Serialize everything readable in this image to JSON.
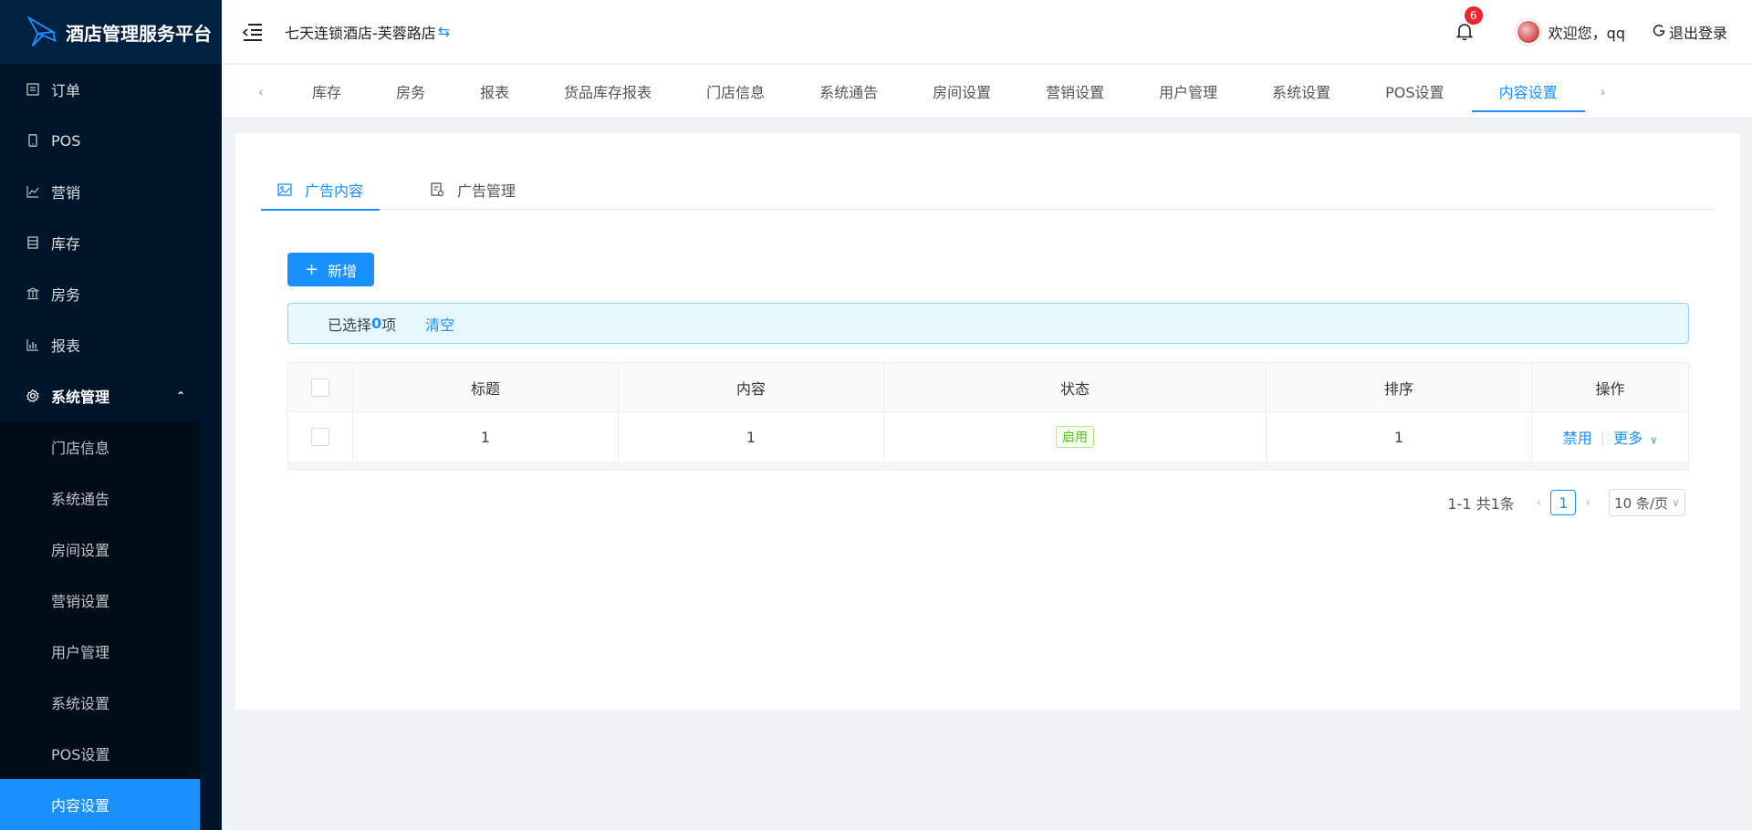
{
  "app": {
    "title": "酒店管理服务平台"
  },
  "sidebar": {
    "items": [
      {
        "label": "订单",
        "icon": "order-icon"
      },
      {
        "label": "POS",
        "icon": "mobile-icon"
      },
      {
        "label": "营销",
        "icon": "line-chart-icon"
      },
      {
        "label": "库存",
        "icon": "inventory-icon"
      },
      {
        "label": "房务",
        "icon": "bank-icon"
      },
      {
        "label": "报表",
        "icon": "bar-chart-icon"
      }
    ],
    "open_group": {
      "label": "系统管理",
      "icon": "gear-icon"
    },
    "sub_items": [
      {
        "label": "门店信息"
      },
      {
        "label": "系统通告"
      },
      {
        "label": "房间设置"
      },
      {
        "label": "营销设置"
      },
      {
        "label": "用户管理"
      },
      {
        "label": "系统设置"
      },
      {
        "label": "POS设置"
      },
      {
        "label": "内容设置",
        "active": true
      }
    ]
  },
  "header": {
    "hotel_name": "七天连锁酒店-芙蓉路店",
    "swap_glyph": "⇆",
    "notification_count": "6",
    "welcome": "欢迎您，qq",
    "logout_label": "退出登录"
  },
  "tabbar": {
    "tabs": [
      "库存",
      "房务",
      "报表",
      "货品库存报表",
      "门店信息",
      "系统通告",
      "房间设置",
      "营销设置",
      "用户管理",
      "系统设置",
      "POS设置",
      "内容设置"
    ],
    "active_tab": "内容设置"
  },
  "content": {
    "inner_tabs": [
      {
        "label": "广告内容",
        "icon": "picture-icon",
        "active": true
      },
      {
        "label": "广告管理",
        "icon": "ad-manage-icon",
        "active": false
      }
    ],
    "add_button": "新增",
    "selection": {
      "prefix": "已选择 ",
      "count": "0",
      "suffix": "项",
      "clear": "清空"
    },
    "table": {
      "columns": [
        "标题",
        "内容",
        "状态",
        "排序",
        "操作"
      ],
      "rows": [
        {
          "title": "1",
          "content": "1",
          "status": "启用",
          "sort": "1",
          "op_disable": "禁用",
          "op_more": "更多"
        }
      ]
    },
    "pagination": {
      "total_text": "1-1 共1条",
      "current_page": "1",
      "page_size": "10 条/页"
    }
  },
  "colors": {
    "primary": "#1890ff",
    "sidebar_bg": "#001529",
    "success": "#52c41a",
    "badge": "#f5222d"
  }
}
